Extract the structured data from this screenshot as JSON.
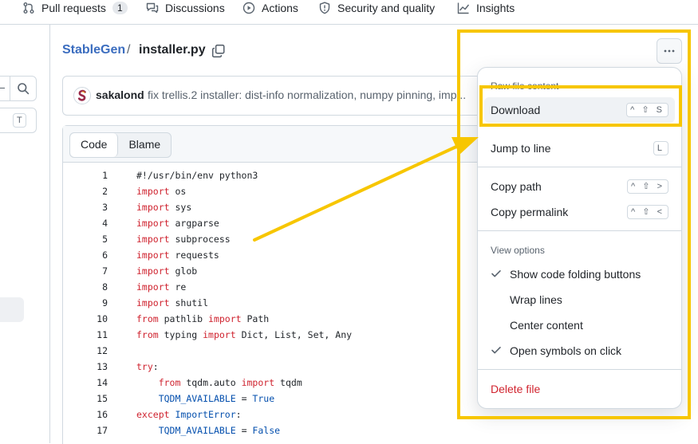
{
  "nav": {
    "pull_requests": "Pull requests",
    "pull_requests_count": "1",
    "discussions": "Discussions",
    "actions": "Actions",
    "security": "Security and quality",
    "insights": "Insights"
  },
  "sidebar": {
    "filter_shortcut": "T"
  },
  "breadcrumb": {
    "repo": "StableGen",
    "separator": "/",
    "file": "installer.py"
  },
  "commit": {
    "author": "sakalond",
    "message": "fix trellis.2 installer: dist-info normalization, numpy pinning, imp..."
  },
  "code_view": {
    "tabs": [
      "Code",
      "Blame"
    ],
    "active_tab": "Code",
    "lines": [
      {
        "n": "1",
        "text": "#!/usr/bin/env python3"
      },
      {
        "n": "2",
        "kw": "import",
        "text": " os"
      },
      {
        "n": "3",
        "kw": "import",
        "text": " sys"
      },
      {
        "n": "4",
        "kw": "import",
        "text": " argparse"
      },
      {
        "n": "5",
        "kw": "import",
        "text": " subprocess"
      },
      {
        "n": "6",
        "kw": "import",
        "text": " requests"
      },
      {
        "n": "7",
        "kw": "import",
        "text": " glob"
      },
      {
        "n": "8",
        "kw": "import",
        "text": " re"
      },
      {
        "n": "9",
        "kw": "import",
        "text": " shutil"
      },
      {
        "n": "10",
        "kw": "from",
        "text": " pathlib ",
        "kw2": "import",
        "text2": " Path"
      },
      {
        "n": "11",
        "kw": "from",
        "text": " typing ",
        "kw2": "import",
        "text2": " Dict, List, Set, Any"
      },
      {
        "n": "12",
        "text": ""
      },
      {
        "n": "13",
        "kw": "try",
        "text": ":"
      },
      {
        "n": "14",
        "indent": true,
        "kw": "from",
        "text": " tqdm.auto ",
        "kw2": "import",
        "text2": " tqdm"
      },
      {
        "n": "15",
        "indent": true,
        "const": "TQDM_AVAILABLE",
        "text": " = ",
        "const2": "True"
      },
      {
        "n": "16",
        "kw": "except",
        "text": " ",
        "kwb": "ImportError",
        "textb": ":"
      },
      {
        "n": "17",
        "indent": true,
        "const": "TQDM_AVAILABLE",
        "text": " = ",
        "const2": "False"
      }
    ]
  },
  "menu": {
    "group_raw": "Raw file content",
    "download": "Download",
    "download_keys": [
      "^",
      "⇧",
      "S"
    ],
    "jump_to_line": "Jump to line",
    "jump_keys": [
      "L"
    ],
    "copy_path": "Copy path",
    "copy_path_keys": [
      "^",
      "⇧",
      ">"
    ],
    "copy_permalink": "Copy permalink",
    "copy_permalink_keys": [
      "^",
      "⇧",
      "<"
    ],
    "group_view": "View options",
    "show_folding": "Show code folding buttons",
    "wrap_lines": "Wrap lines",
    "center_content": "Center content",
    "open_symbols": "Open symbols on click",
    "delete_file": "Delete file"
  },
  "colors": {
    "highlight": "#f7c600",
    "link": "#3b6dbf",
    "keyword": "#cf222e",
    "constant": "#0550ae",
    "danger": "#d1242f"
  }
}
